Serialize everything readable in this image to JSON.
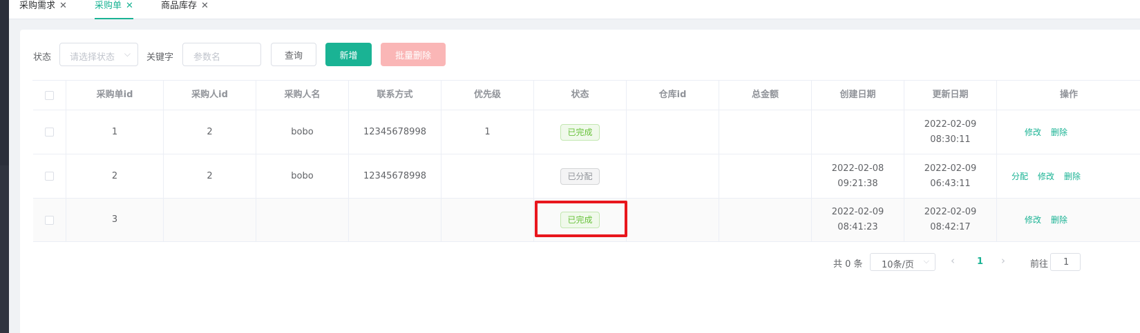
{
  "tabs": [
    {
      "label": "采购需求",
      "close": "✕"
    },
    {
      "label": "采购单",
      "close": "✕"
    },
    {
      "label": "商品库存",
      "close": "✕"
    }
  ],
  "filter": {
    "status_label": "状态",
    "status_placeholder": "请选择状态",
    "keyword_label": "关键字",
    "keyword_placeholder": "参数名",
    "query_button": "查询",
    "add_button": "新增",
    "batch_delete_button": "批量删除"
  },
  "table": {
    "headers": [
      "采购单id",
      "采购人id",
      "采购人名",
      "联系方式",
      "优先级",
      "状态",
      "仓库id",
      "总金额",
      "创建日期",
      "更新日期",
      "操作"
    ],
    "rows": [
      {
        "id": "1",
        "buyer_id": "2",
        "buyer_name": "bobo",
        "contact": "12345678998",
        "priority": "1",
        "status": "已完成",
        "warehouse_id": "",
        "total": "",
        "created": "",
        "updated": "2022-02-09 08:30:11",
        "ops": [
          "修改",
          "删除"
        ]
      },
      {
        "id": "2",
        "buyer_id": "2",
        "buyer_name": "bobo",
        "contact": "12345678998",
        "priority": "",
        "status": "已分配",
        "warehouse_id": "",
        "total": "",
        "created": "2022-02-08 09:21:38",
        "updated": "2022-02-09 06:43:11",
        "ops": [
          "分配",
          "修改",
          "删除"
        ]
      },
      {
        "id": "3",
        "buyer_id": "",
        "buyer_name": "",
        "contact": "",
        "priority": "",
        "status": "已完成",
        "warehouse_id": "",
        "total": "",
        "created": "2022-02-09 08:41:23",
        "updated": "2022-02-09 08:42:17",
        "ops": [
          "修改",
          "删除"
        ]
      }
    ]
  },
  "pagination": {
    "total": "共 0 条",
    "page_size": "10条/页",
    "current_page": "1",
    "goto_label": "前往",
    "goto_value": "1"
  },
  "colors": {
    "primary": "#1ab394",
    "danger_light": "#fab6b6",
    "highlight": "#e8161d",
    "success_tag": "#67c23a",
    "info_tag": "#909399"
  }
}
